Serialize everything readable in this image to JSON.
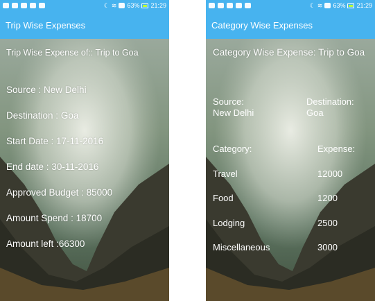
{
  "status_bar": {
    "battery": "63%",
    "time": "21:29"
  },
  "left_screen": {
    "title": "Trip Wise Expenses",
    "header": "Trip Wise Expense of:: Trip to Goa",
    "rows": [
      {
        "label": "Source",
        "sep": " : ",
        "value": "New Delhi"
      },
      {
        "label": "Destination",
        "sep": "  : ",
        "value": "Goa"
      },
      {
        "label": "Start Date",
        "sep": "  : ",
        "value": "17-11-2016"
      },
      {
        "label": "End date",
        "sep": "  : ",
        "value": "30-11-2016"
      },
      {
        "label": "Approved Budget",
        "sep": " : ",
        "value": "85000"
      },
      {
        "label": "Amount Spend",
        "sep": "    : ",
        "value": "18700"
      },
      {
        "label": "Amount left",
        "sep": "   :",
        "value": "66300"
      }
    ]
  },
  "right_screen": {
    "title": "Category Wise Expenses",
    "header": "Category Wise Expense: Trip to Goa",
    "source_label": "Source:",
    "source_value": "New Delhi",
    "destination_label": "Destination:",
    "destination_value": "Goa",
    "category_header": "Category:",
    "expense_header": "Expense:",
    "categories": [
      {
        "name": "Travel",
        "amount": "12000"
      },
      {
        "name": "Food",
        "amount": "1200"
      },
      {
        "name": "Lodging",
        "amount": "2500"
      },
      {
        "name": "Miscellaneous",
        "amount": "3000"
      }
    ]
  },
  "colors": {
    "app_bar": "#47b3ef",
    "text": "#ffffff"
  }
}
